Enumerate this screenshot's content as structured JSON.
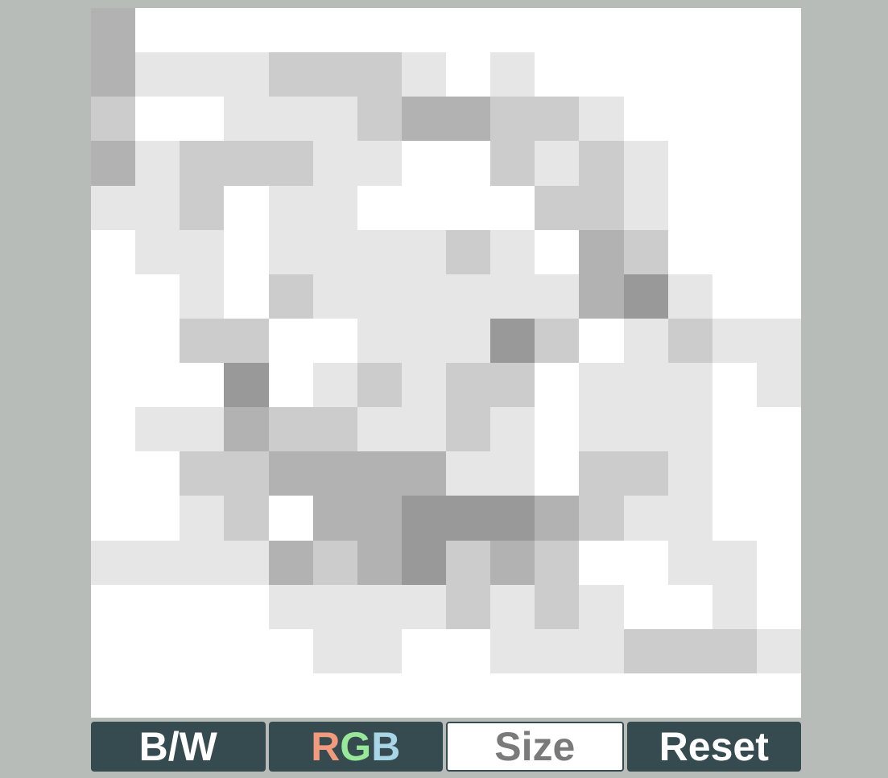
{
  "palette": {
    "0": "#ffffff",
    "1": "#e6e6e6",
    "2": "#cccccc",
    "3": "#b2b2b2",
    "4": "#999999"
  },
  "pixel_grid": [
    "3000000000000000",
    "3111222101000000",
    "2001112332210000",
    "3122211002121000",
    "1120110000221000",
    "0110111121032000",
    "0010211111134100",
    "0022001114201211",
    "0004012122011101",
    "0113221121011100",
    "0022333311022100",
    "0012033444321100",
    "1111323423200110",
    "0000111121210010",
    "0000011001112221",
    "0000000000000000"
  ],
  "toolbar": {
    "bw_label": "B/W",
    "rgb_r": "R",
    "rgb_g": "G",
    "rgb_b": "B",
    "size_label": "Size",
    "reset_label": "Reset"
  },
  "colors": {
    "button_bg": "#364b50",
    "button_text": "#ffffff",
    "size_text": "#7a7a7a",
    "rgb_r": "#f29a7e",
    "rgb_g": "#98e89a",
    "rgb_b": "#a9d6e6",
    "background": "#b7bcb8"
  }
}
